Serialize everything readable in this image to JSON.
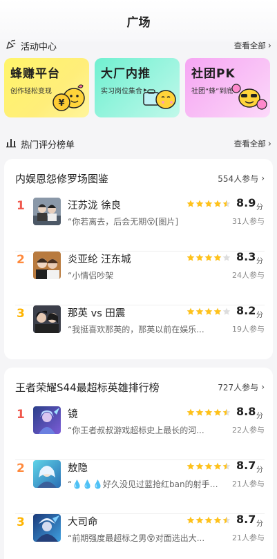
{
  "header": {
    "title": "广场"
  },
  "activity": {
    "title": "活动中心",
    "more_label": "查看全部",
    "cards": [
      {
        "title": "蜂赚平台",
        "subtitle": "创作轻松变现",
        "accent": "#fff56a"
      },
      {
        "title": "大厂内推",
        "subtitle": "实习岗位集合",
        "accent": "#70f0d0"
      },
      {
        "title": "社团PK",
        "subtitle": "社团“蜂”到底",
        "accent": "#f6a6f3"
      }
    ]
  },
  "ranking": {
    "title": "热门评分榜单",
    "more_label": "查看全部"
  },
  "boards": [
    {
      "title": "内娱恩怨修罗场图鉴",
      "count": "554人参与",
      "items": [
        {
          "rank": "1",
          "name": "汪苏泷 徐良",
          "quote": "“你若离去，后会无期😵[图片]",
          "rating_stars": 4.5,
          "score": "8.9",
          "unit": "分",
          "joined": "31人参与"
        },
        {
          "rank": "2",
          "name": "炎亚纶 汪东城",
          "quote": "“小情侣吵架",
          "rating_stars": 4,
          "score": "8.3",
          "unit": "分",
          "joined": "24人参与"
        },
        {
          "rank": "3",
          "name": "那英 vs 田震",
          "quote": "“我挺喜欢那英的，那英以前在娱乐...",
          "rating_stars": 4,
          "score": "8.2",
          "unit": "分",
          "joined": "19人参与"
        }
      ]
    },
    {
      "title": "王者荣耀S44最超标英雄排行榜",
      "count": "727人参与",
      "items": [
        {
          "rank": "1",
          "name": "镜",
          "quote": "“你王者叔叔游戏超标史上最长的河...",
          "rating_stars": 4.5,
          "score": "8.8",
          "unit": "分",
          "joined": "22人参与"
        },
        {
          "rank": "2",
          "name": "敖隐",
          "quote": "“💧💧💧好久没见过蓝抢红ban的射手了...",
          "rating_stars": 4.5,
          "score": "8.7",
          "unit": "分",
          "joined": "21人参与"
        },
        {
          "rank": "3",
          "name": "大司命",
          "quote": "“前期强度最超标之男😵对面选出大...",
          "rating_stars": 4.5,
          "score": "8.7",
          "unit": "分",
          "joined": "21人参与"
        }
      ]
    }
  ],
  "colors": {
    "rank1": "#f0584d",
    "rank2": "#ff8a3d",
    "rank3": "#ffb400",
    "star": "#ffc21a",
    "star_empty": "#dddddd"
  }
}
